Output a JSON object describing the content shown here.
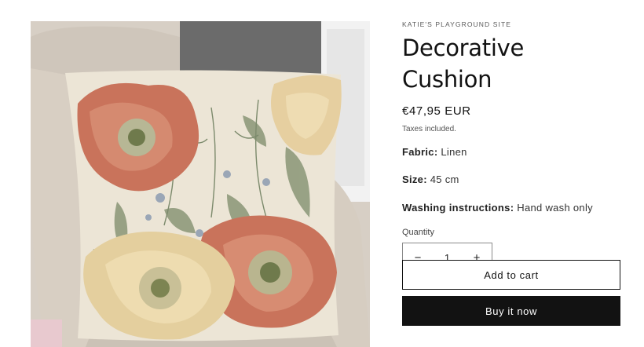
{
  "product": {
    "vendor": "KATIE'S PLAYGROUND SITE",
    "title": "Decorative Cushion",
    "price": "€47,95 EUR",
    "tax_note": "Taxes included.",
    "specs": {
      "fabric": {
        "label": "Fabric:",
        "value": "Linen"
      },
      "size": {
        "label": "Size:",
        "value": "45 cm"
      },
      "washing": {
        "label": "Washing instructions:",
        "value": "Hand wash only"
      }
    },
    "quantity": {
      "label": "Quantity",
      "value": "1",
      "decrease_icon": "minus-icon",
      "increase_icon": "plus-icon",
      "decrease_glyph": "−",
      "increase_glyph": "+"
    },
    "buttons": {
      "add_to_cart": "Add to cart",
      "buy_now": "Buy it now"
    },
    "image": {
      "subject": "cushion-with-poppy-print",
      "colors": {
        "coral": "#c9735b",
        "cream": "#ecdcb0",
        "sage": "#8f9a7c",
        "background": "#ede6d7"
      }
    }
  }
}
